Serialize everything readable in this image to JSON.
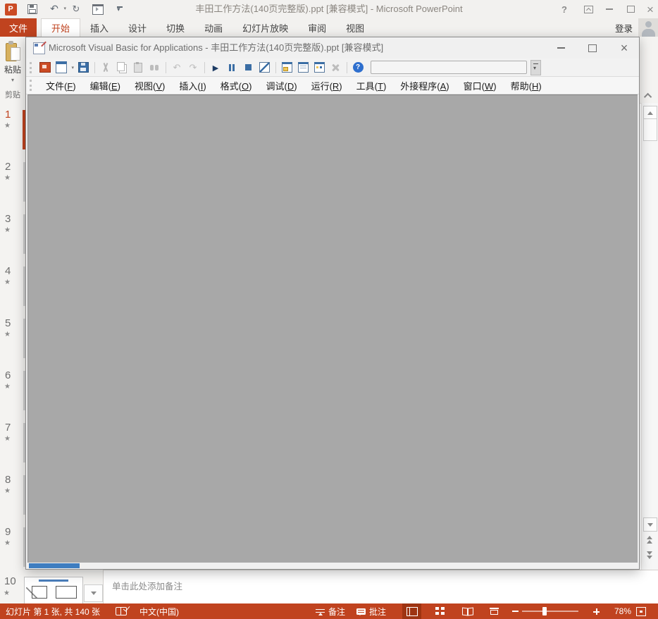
{
  "powerpoint": {
    "title": "丰田工作方法(140页完整版).ppt [兼容模式] - Microsoft PowerPoint",
    "qat": [
      {
        "name": "powerpoint-logo-icon",
        "icon": "powerpoint-logo"
      },
      {
        "name": "save-icon",
        "icon": "save-outline"
      },
      {
        "name": "undo-icon",
        "icon": "undo-arrow",
        "dropdown": true
      },
      {
        "name": "redo-icon",
        "icon": "redo-arrow"
      },
      {
        "name": "start-slideshow-icon",
        "icon": "start-slideshow"
      },
      {
        "name": "customize-qat-icon",
        "icon": "customize-qat"
      }
    ],
    "tabs": {
      "file": "文件",
      "items": [
        {
          "label": "开始",
          "active": true
        },
        {
          "label": "插入"
        },
        {
          "label": "设计"
        },
        {
          "label": "切换"
        },
        {
          "label": "动画"
        },
        {
          "label": "幻灯片放映"
        },
        {
          "label": "审阅"
        },
        {
          "label": "视图"
        }
      ],
      "sign_in": "登录"
    },
    "ribbon": {
      "paste_label": "粘贴",
      "group_label": "剪贴"
    },
    "slides": [
      {
        "num": "1",
        "starred": true,
        "current": true
      },
      {
        "num": "2",
        "starred": true
      },
      {
        "num": "3",
        "starred": true
      },
      {
        "num": "4",
        "starred": true
      },
      {
        "num": "5",
        "starred": true
      },
      {
        "num": "6",
        "starred": true
      },
      {
        "num": "7",
        "starred": true
      },
      {
        "num": "8",
        "starred": true
      },
      {
        "num": "9",
        "starred": true
      }
    ],
    "slide10": {
      "num": "10",
      "starred": true
    },
    "notes_placeholder": "单击此处添加备注",
    "status_bar": {
      "slide_counter": "幻灯片 第 1 张, 共 140 张",
      "language": "中文(中国)",
      "notes_label": "备注",
      "comments_label": "批注",
      "zoom_level": "78%"
    }
  },
  "vba": {
    "title": "Microsoft Visual Basic for Applications - 丰田工作方法(140页完整版).ppt [兼容模式]",
    "menus": [
      "文件(F)",
      "编辑(E)",
      "视图(V)",
      "插入(I)",
      "格式(O)",
      "调试(D)",
      "运行(R)",
      "工具(T)",
      "外接程序(A)",
      "窗口(W)",
      "帮助(H)"
    ],
    "toolbar": [
      {
        "name": "view-powerpoint-icon",
        "icon": "view-powerpoint"
      },
      {
        "name": "insert-userform-icon",
        "icon": "insert-userform",
        "dropdown": true
      },
      {
        "name": "save-icon",
        "icon": "save"
      },
      {
        "name": "toolbar-separator",
        "sep": true
      },
      {
        "name": "cut-icon",
        "icon": "cut",
        "disabled": true
      },
      {
        "name": "copy-icon",
        "icon": "copy",
        "disabled": true
      },
      {
        "name": "paste-icon",
        "icon": "paste",
        "disabled": true
      },
      {
        "name": "find-icon",
        "icon": "find",
        "disabled": true
      },
      {
        "name": "toolbar-separator",
        "sep": true
      },
      {
        "name": "undo-icon",
        "icon": "undo",
        "disabled": true
      },
      {
        "name": "redo-icon",
        "icon": "redo",
        "disabled": true
      },
      {
        "name": "toolbar-separator",
        "sep": true
      },
      {
        "name": "run-icon",
        "icon": "run"
      },
      {
        "name": "break-icon",
        "icon": "break"
      },
      {
        "name": "reset-icon",
        "icon": "reset"
      },
      {
        "name": "design-mode-icon",
        "icon": "design-mode"
      },
      {
        "name": "toolbar-separator",
        "sep": true
      },
      {
        "name": "project-explorer-icon",
        "icon": "project-explorer"
      },
      {
        "name": "properties-window-icon",
        "icon": "properties-window"
      },
      {
        "name": "object-browser-icon",
        "icon": "object-browser"
      },
      {
        "name": "toolbox-icon",
        "icon": "toolbox",
        "disabled": true
      },
      {
        "name": "toolbar-separator",
        "sep": true
      },
      {
        "name": "help-icon",
        "icon": "help"
      }
    ]
  },
  "icons": {
    "animation-star": "★",
    "run": "▶",
    "undo": "↶",
    "redo": "↷",
    "dropdown": "▾",
    "scroll-up": "▲",
    "scroll-down": "▼",
    "help": "?",
    "close": "×"
  },
  "colors": {
    "accent_red": "#C0431F",
    "status_pressed": "#9E3412",
    "vba_client_gray": "#A8A8A8",
    "blue_strip": "#3E7DC0",
    "title_text_gray": "#8B8680"
  }
}
